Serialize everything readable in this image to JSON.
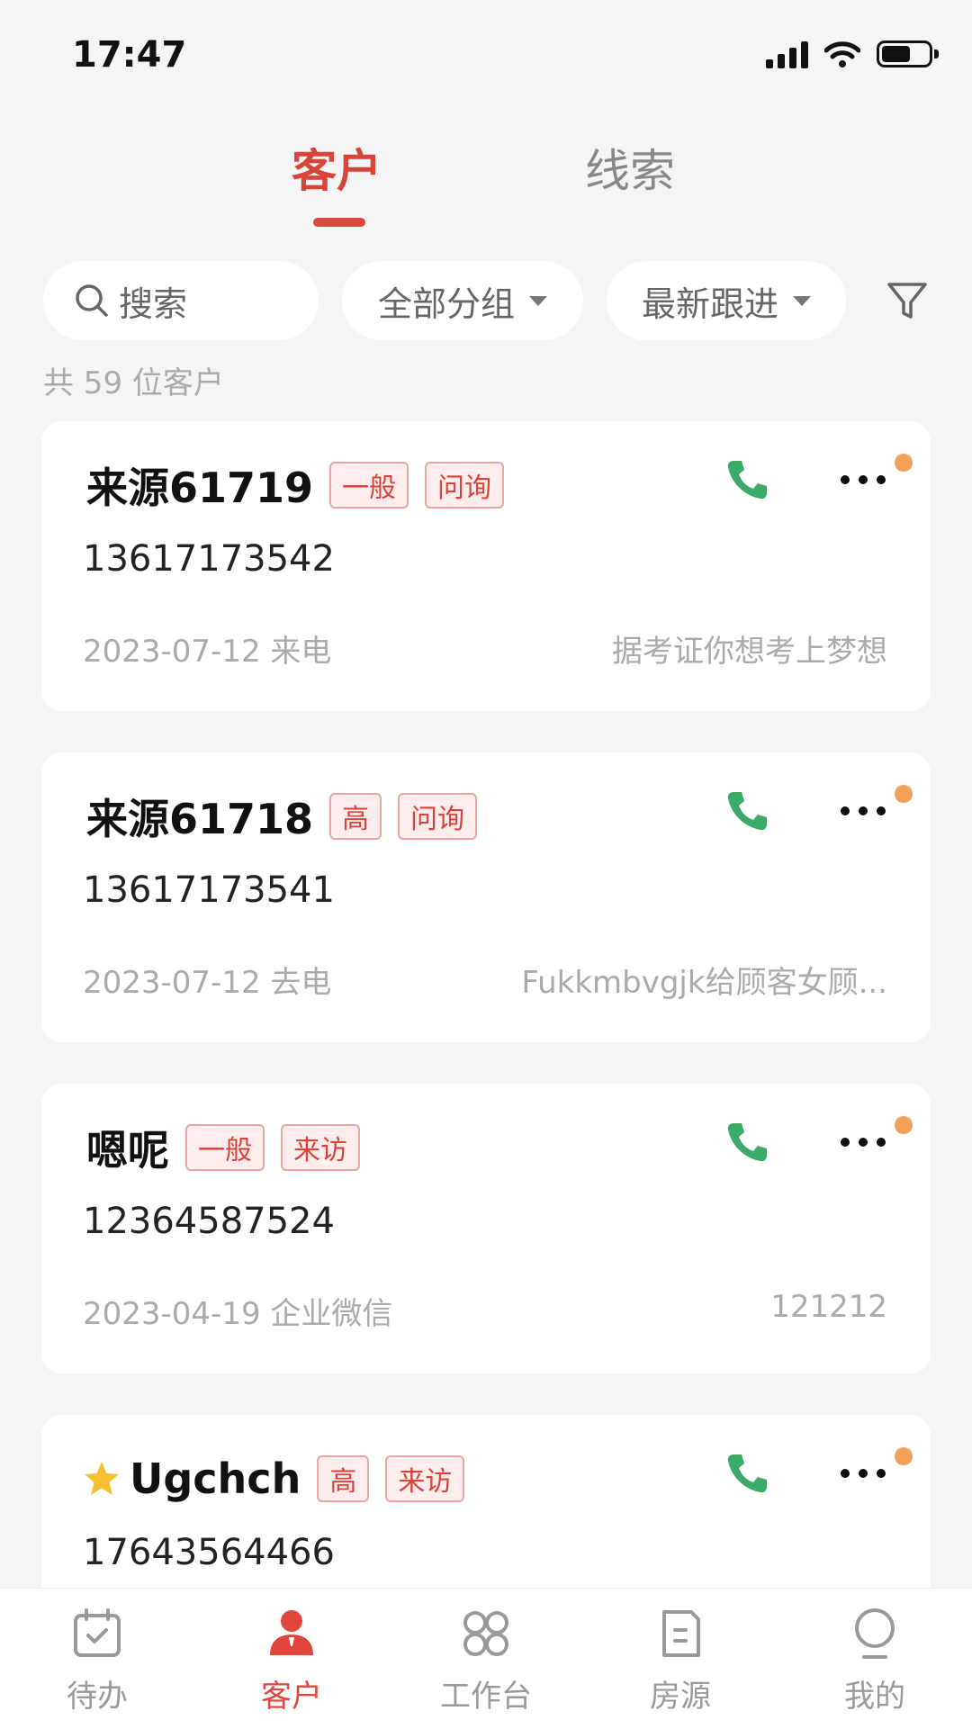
{
  "status_bar": {
    "time": "17:47"
  },
  "top_tabs": {
    "active": "客户",
    "inactive": "线索"
  },
  "filters": {
    "search_label": "搜索",
    "group_label": "全部分组",
    "sort_label": "最新跟进"
  },
  "count_text": "共 59 位客户",
  "customers": [
    {
      "name": "来源61719",
      "tags": [
        "一般",
        "问询"
      ],
      "phone": "13617173542",
      "meta": "2023-07-12 来电",
      "note": "据考证你想考上梦想",
      "starred": false
    },
    {
      "name": "来源61718",
      "tags": [
        "高",
        "问询"
      ],
      "phone": "13617173541",
      "meta": "2023-07-12 去电",
      "note": "Fukkmbvgjk给顾客女顾...",
      "starred": false
    },
    {
      "name": "嗯呢",
      "tags": [
        "一般",
        "来访"
      ],
      "phone": "12364587524",
      "meta": "2023-04-19 企业微信",
      "note": "121212",
      "starred": false
    },
    {
      "name": "Ugchch",
      "tags": [
        "高",
        "来访"
      ],
      "phone": "17643564466",
      "meta": "",
      "note": "",
      "starred": true
    }
  ],
  "bottom_nav": [
    {
      "label": "待办",
      "icon": "todo-icon",
      "active": false
    },
    {
      "label": "客户",
      "icon": "customer-icon",
      "active": true
    },
    {
      "label": "工作台",
      "icon": "workbench-icon",
      "active": false
    },
    {
      "label": "房源",
      "icon": "listing-icon",
      "active": false
    },
    {
      "label": "我的",
      "icon": "profile-icon",
      "active": false
    }
  ],
  "colors": {
    "accent": "#e0463d",
    "phone_green": "#3daa6a",
    "unread_dot": "#f0a05a"
  }
}
